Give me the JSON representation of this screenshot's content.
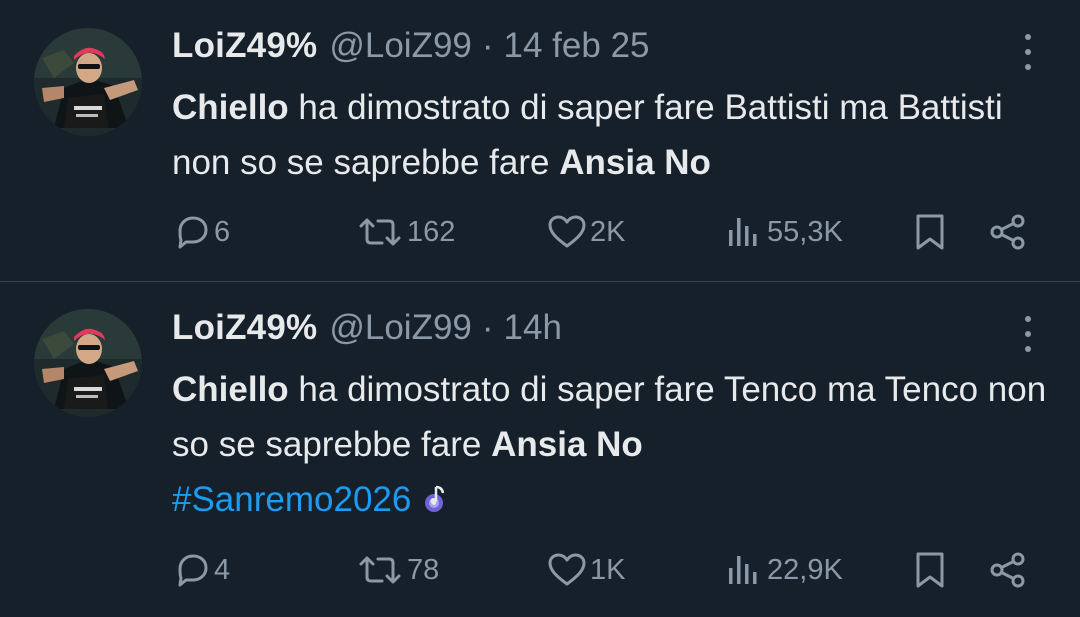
{
  "tweets": [
    {
      "author": {
        "name": "LoiZ49%",
        "handle": "@LoiZ99"
      },
      "separator": "·",
      "time": "14 feb 25",
      "text": {
        "bold1": "Chiello",
        "part1": " ha dimostrato di saper fare Battisti ma Battisti non so se saprebbe fare ",
        "bold2": "Ansia No"
      },
      "stats": {
        "replies": "6",
        "reposts": "162",
        "likes": "2K",
        "views": "55,3K"
      }
    },
    {
      "author": {
        "name": "LoiZ49%",
        "handle": "@LoiZ99"
      },
      "separator": "·",
      "time": "14h",
      "text": {
        "bold1": "Chiello",
        "part1": " ha dimostrato di saper fare Tenco ma Tenco non so se saprebbe fare ",
        "bold2": "Ansia No",
        "hashtag": "#Sanremo2026"
      },
      "stats": {
        "replies": "4",
        "reposts": "78",
        "likes": "1K",
        "views": "22,9K"
      }
    }
  ],
  "colors": {
    "background": "#15202b",
    "text_primary": "#e7e9ea",
    "text_secondary": "#8b98a5",
    "link": "#1d9bf0",
    "divider": "#38444d"
  },
  "icons": [
    "more-vertical-icon",
    "reply-icon",
    "repost-icon",
    "like-heart-icon",
    "views-chart-icon",
    "bookmark-icon",
    "share-icon",
    "music-note-emoji"
  ]
}
